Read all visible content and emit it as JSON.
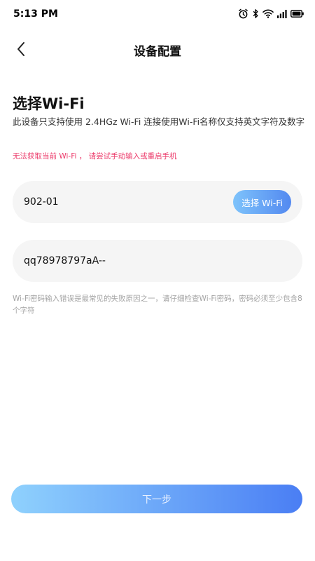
{
  "status_bar": {
    "time": "5:13 PM",
    "icons": [
      "alarm-icon",
      "bluetooth-icon",
      "wifi-icon",
      "signal-icon",
      "battery-icon"
    ]
  },
  "nav": {
    "title": "设备配置",
    "back_icon": "chevron-left-icon"
  },
  "section": {
    "title": "选择Wi-Fi",
    "description": "此设备只支持使用 2.4HGz Wi-Fi 连接使用Wi-Fi名称仅支持英文字符及数字",
    "error": "无法获取当前 Wi-Fi ， 请尝试手动输入或重启手机"
  },
  "ssid_field": {
    "value": "902-01",
    "button_label": "选择 Wi-Fi"
  },
  "password_field": {
    "value": "qq78978797aA--"
  },
  "password_hint": "Wi-Fi密码输入错误是最常见的失败原因之一，请仔细检查Wi-Fi密码，密码必须至少包含8个字符",
  "next_button": {
    "label": "下一步"
  },
  "colors": {
    "error": "#ec3a6a",
    "hint": "#a3a3a3",
    "input_bg": "#f5f5f5",
    "accent_start": "#8fd1fd",
    "accent_end": "#4a7ef4"
  }
}
